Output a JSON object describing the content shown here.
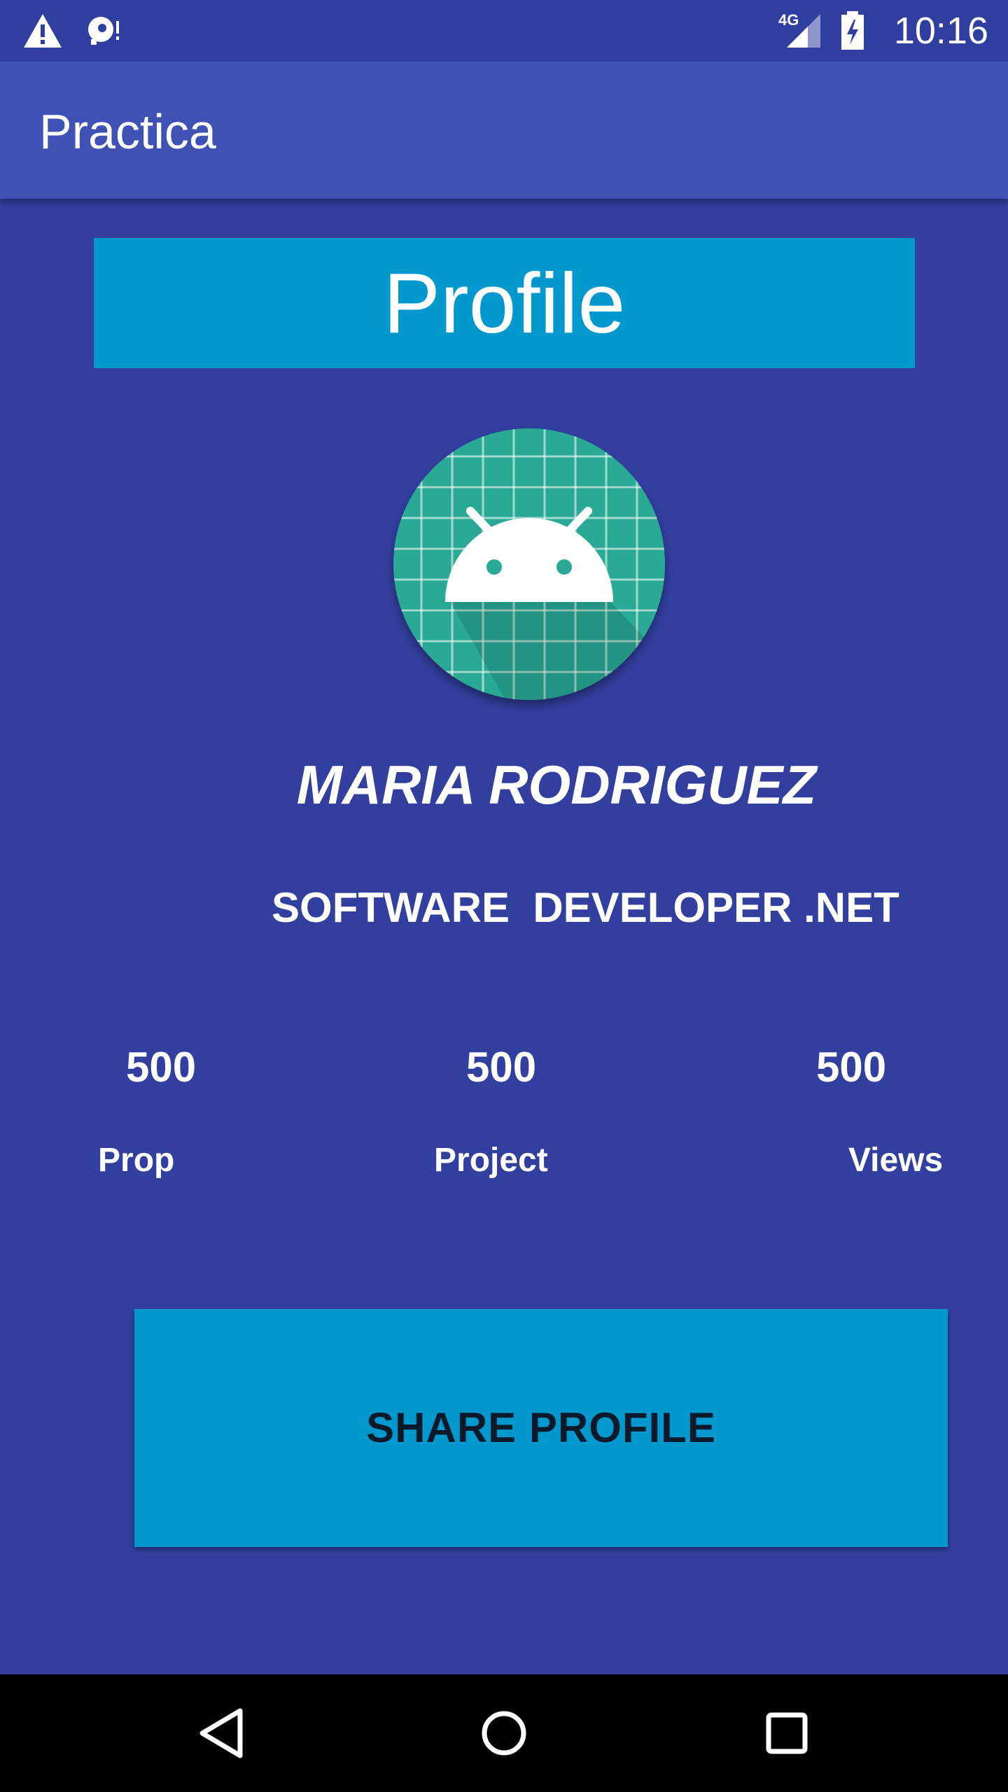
{
  "status_bar": {
    "time": "10:16",
    "network_label": "4G",
    "icons": [
      "warning-icon",
      "sd-card-alert-icon",
      "signal-4g-icon",
      "battery-charging-icon"
    ]
  },
  "app_bar": {
    "title": "Practica"
  },
  "profile": {
    "header": "Profile",
    "avatar_icon": "android-robot-icon",
    "name": "MARIA RODRIGUEZ",
    "role": "SOFTWARE  DEVELOPER .NET"
  },
  "stats": [
    {
      "value": "500",
      "label": "Prop"
    },
    {
      "value": "500",
      "label": "Project"
    },
    {
      "value": "500",
      "label": "Views"
    }
  ],
  "actions": {
    "share_label": "SHARE PROFILE"
  },
  "nav_bar": {
    "icons": [
      "back-icon",
      "home-icon",
      "recents-icon"
    ]
  },
  "colors": {
    "background": "#323f9e",
    "status_bar": "#303f9f",
    "app_bar": "#3f51b5",
    "accent": "#0098cd",
    "avatar": "#2aa995"
  }
}
